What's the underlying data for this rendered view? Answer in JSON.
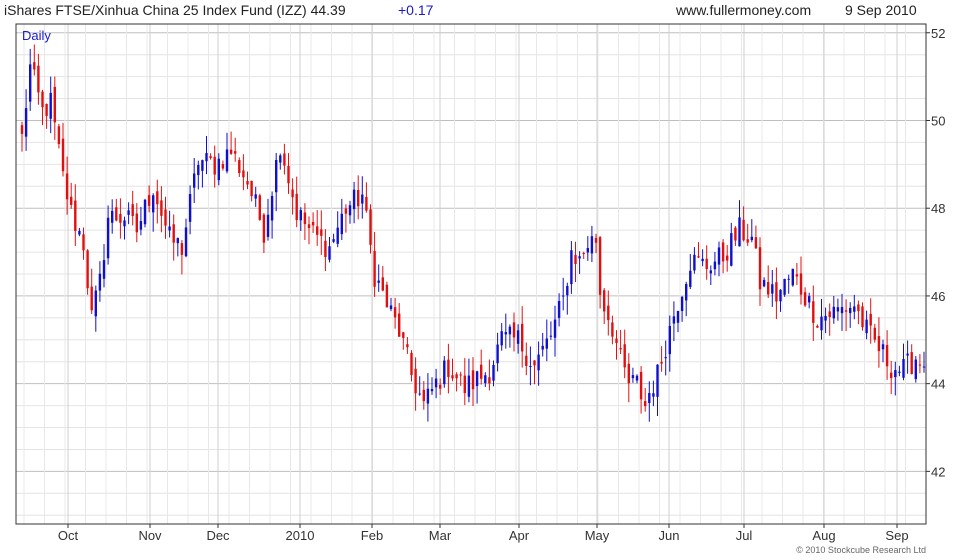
{
  "header": {
    "title": "iShares FTSE/Xinhua China 25 Index Fund (IZZ) 44.39",
    "change": "+0.17",
    "site": "www.fullermoney.com",
    "date": "9 Sep 2010"
  },
  "footer": {
    "copyright": "© 2010 Stockcube Research Ltd"
  },
  "colors": {
    "up": "#1010cc",
    "down": "#e01010",
    "grid": "#d8d8d8",
    "axis": "#333333"
  },
  "chart_data": {
    "type": "bar",
    "subtype": "daily OHLC bars",
    "title": "iShares FTSE/Xinhua China 25 Index Fund (IZZ)",
    "last_price": 44.39,
    "change": 0.17,
    "period_label": "Daily",
    "ylim": [
      40.8,
      52.2
    ],
    "yticks": [
      42,
      44,
      46,
      48,
      50,
      52
    ],
    "xticks": [
      "Oct",
      "Nov",
      "Dec",
      "2010",
      "Feb",
      "Mar",
      "Apr",
      "May",
      "Jun",
      "Jul",
      "Aug",
      "Sep"
    ],
    "grid": true,
    "y_axis_side": "right",
    "anchors": [
      [
        0,
        49.6
      ],
      [
        2,
        51.2
      ],
      [
        5,
        50.2
      ],
      [
        7,
        50.4
      ],
      [
        10,
        48.7
      ],
      [
        12,
        47.9
      ],
      [
        15,
        47.2
      ],
      [
        17,
        45.5
      ],
      [
        19,
        46.3
      ],
      [
        21,
        47.8
      ],
      [
        25,
        47.8
      ],
      [
        28,
        47.5
      ],
      [
        32,
        48.5
      ],
      [
        36,
        47.3
      ],
      [
        39,
        47.1
      ],
      [
        43,
        49.1
      ],
      [
        47,
        49.0
      ],
      [
        51,
        49.3
      ],
      [
        55,
        48.6
      ],
      [
        59,
        47.5
      ],
      [
        63,
        49.5
      ],
      [
        67,
        47.9
      ],
      [
        71,
        47.4
      ],
      [
        75,
        47.1
      ],
      [
        79,
        48.0
      ],
      [
        83,
        48.3
      ],
      [
        86,
        46.5
      ],
      [
        89,
        45.8
      ],
      [
        92,
        45.2
      ],
      [
        95,
        44.2
      ],
      [
        98,
        43.5
      ],
      [
        101,
        44.0
      ],
      [
        104,
        44.4
      ],
      [
        108,
        43.9
      ],
      [
        111,
        44.1
      ],
      [
        114,
        44.3
      ],
      [
        117,
        45.0
      ],
      [
        121,
        45.0
      ],
      [
        125,
        44.4
      ],
      [
        129,
        45.1
      ],
      [
        132,
        45.9
      ],
      [
        134,
        47.0
      ],
      [
        136,
        46.8
      ],
      [
        138,
        47.2
      ],
      [
        140,
        47.3
      ],
      [
        141,
        46.1
      ],
      [
        142,
        45.8
      ],
      [
        144,
        45.3
      ],
      [
        146,
        44.5
      ],
      [
        148,
        44.0
      ],
      [
        150,
        44.0
      ],
      [
        152,
        43.5
      ],
      [
        153,
        43.8
      ],
      [
        155,
        44.2
      ],
      [
        157,
        44.9
      ],
      [
        159,
        45.6
      ],
      [
        161,
        46.2
      ],
      [
        163,
        46.8
      ],
      [
        167,
        46.7
      ],
      [
        171,
        46.9
      ],
      [
        175,
        47.5
      ],
      [
        178,
        47.3
      ],
      [
        180,
        46.3
      ],
      [
        184,
        46.0
      ],
      [
        188,
        46.5
      ],
      [
        191,
        46.0
      ],
      [
        194,
        45.5
      ],
      [
        197,
        45.6
      ],
      [
        200,
        45.7
      ],
      [
        203,
        45.8
      ],
      [
        206,
        45.2
      ],
      [
        209,
        44.8
      ],
      [
        212,
        44.4
      ],
      [
        215,
        44.3
      ],
      [
        218,
        44.6
      ],
      [
        220,
        44.39
      ]
    ]
  }
}
